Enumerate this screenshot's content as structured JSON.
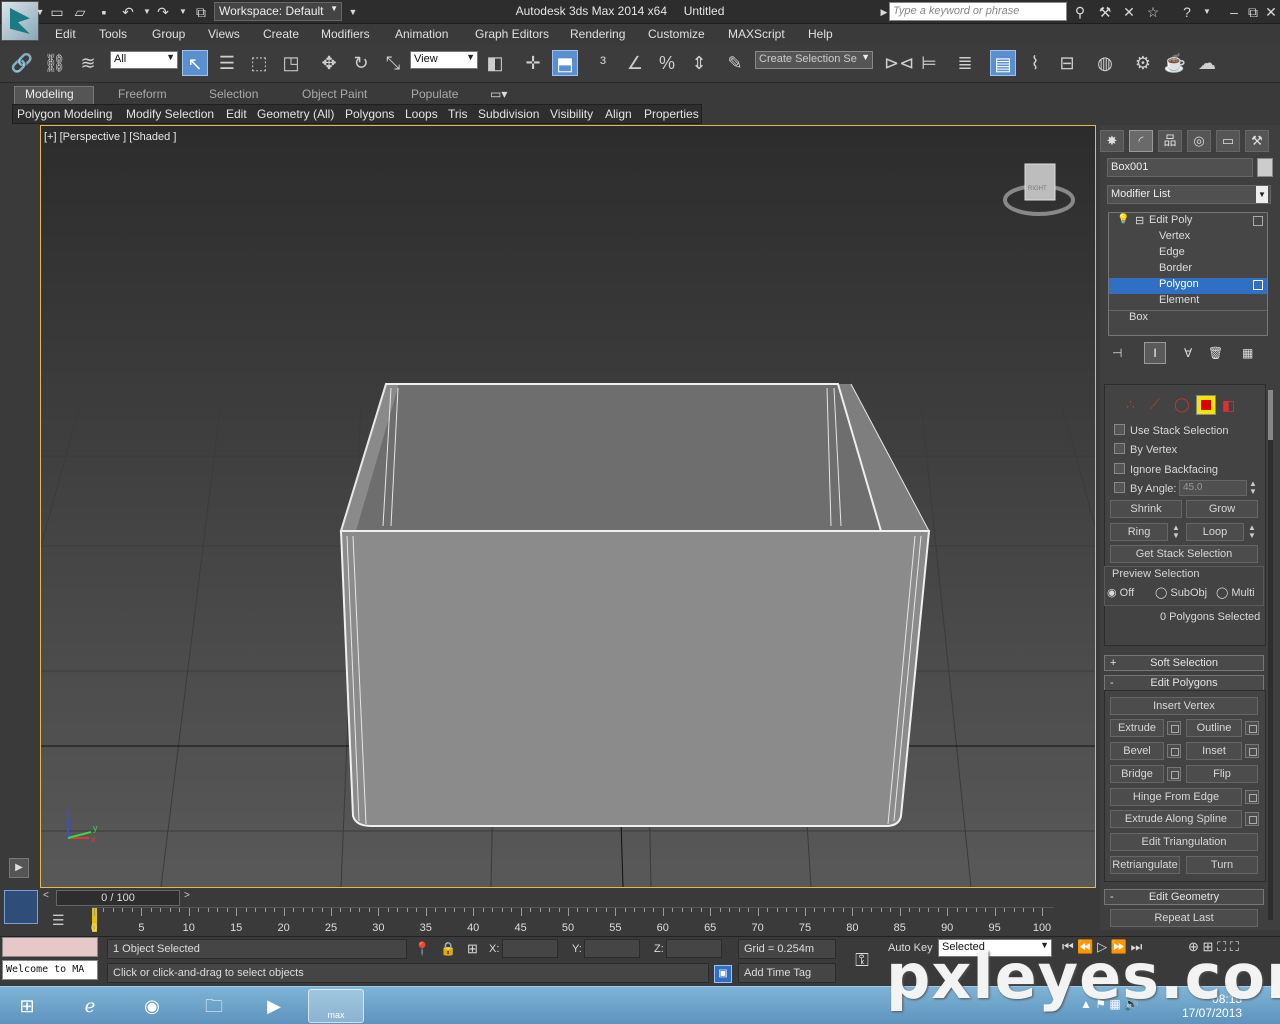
{
  "window": {
    "title": "Autodesk 3ds Max  2014 x64",
    "document": "Untitled",
    "workspace": "Workspace: Default",
    "search_placeholder": "Type a keyword or phrase"
  },
  "menu": [
    "Edit",
    "Tools",
    "Group",
    "Views",
    "Create",
    "Modifiers",
    "Animation",
    "Graph Editors",
    "Rendering",
    "Customize",
    "MAXScript",
    "Help"
  ],
  "toolbar": {
    "filter": "All",
    "ref_coord": "View",
    "selection_set": "Create Selection Se"
  },
  "ribbon": {
    "tabs": [
      "Modeling",
      "Freeform",
      "Selection",
      "Object Paint",
      "Populate"
    ],
    "sub": [
      "Polygon Modeling",
      "Modify Selection",
      "Edit",
      "Geometry (All)",
      "Polygons",
      "Loops",
      "Tris",
      "Subdivision",
      "Visibility",
      "Align",
      "Properties"
    ]
  },
  "viewport": {
    "label": "[+] [Perspective ] [Shaded ]",
    "viewcube_face": "RIGHT",
    "axes": {
      "z": "z",
      "x": "x",
      "y": "y"
    }
  },
  "command_panel": {
    "object_name": "Box001",
    "modifier_list": "Modifier List",
    "stack": {
      "root": "Edit Poly",
      "items": [
        "Vertex",
        "Edge",
        "Border",
        "Polygon",
        "Element"
      ],
      "selected": "Polygon",
      "base": "Box"
    },
    "selection": {
      "use_stack": "Use Stack Selection",
      "by_vertex": "By Vertex",
      "ignore_backfacing": "Ignore Backfacing",
      "by_angle": "By Angle:",
      "angle_value": "45.0",
      "shrink": "Shrink",
      "grow": "Grow",
      "ring": "Ring",
      "loop": "Loop",
      "get_stack": "Get Stack Selection",
      "preview": "Preview Selection",
      "off": "Off",
      "subobj": "SubObj",
      "multi": "Multi",
      "count": "0 Polygons Selected"
    },
    "rollouts": {
      "soft": "Soft Selection",
      "soft_pm": "+",
      "edit_polygons": "Edit Polygons",
      "edit_polygons_pm": "-",
      "edit_geometry": "Edit Geometry",
      "edit_geometry_pm": "-"
    },
    "edit_polygons": {
      "insert_vertex": "Insert Vertex",
      "extrude": "Extrude",
      "outline": "Outline",
      "bevel": "Bevel",
      "inset": "Inset",
      "bridge": "Bridge",
      "flip": "Flip",
      "hinge": "Hinge From Edge",
      "extrude_spline": "Extrude Along Spline",
      "edit_tri": "Edit Triangulation",
      "retriangulate": "Retriangulate",
      "turn": "Turn"
    },
    "edit_geometry": {
      "repeat_last": "Repeat Last"
    }
  },
  "timeline": {
    "slider": "0 / 100",
    "ticks": [
      "0",
      "5",
      "10",
      "15",
      "20",
      "25",
      "30",
      "35",
      "40",
      "45",
      "50",
      "55",
      "60",
      "65",
      "70",
      "75",
      "80",
      "85",
      "90",
      "95",
      "100"
    ]
  },
  "status": {
    "selection": "1 Object Selected",
    "prompt": "Click or click-and-drag to select objects",
    "maxscript": "Welcome to MA",
    "x": "X:",
    "y": "Y:",
    "z": "Z:",
    "grid": "Grid = 0.254m",
    "auto_key": "Auto Key",
    "key_mode": "Selected",
    "add_time_tag": "Add Time Tag"
  },
  "taskbar": {
    "time": "08:15",
    "date": "17/07/2013",
    "max_label": "max"
  },
  "watermark": "pxleyes.com"
}
